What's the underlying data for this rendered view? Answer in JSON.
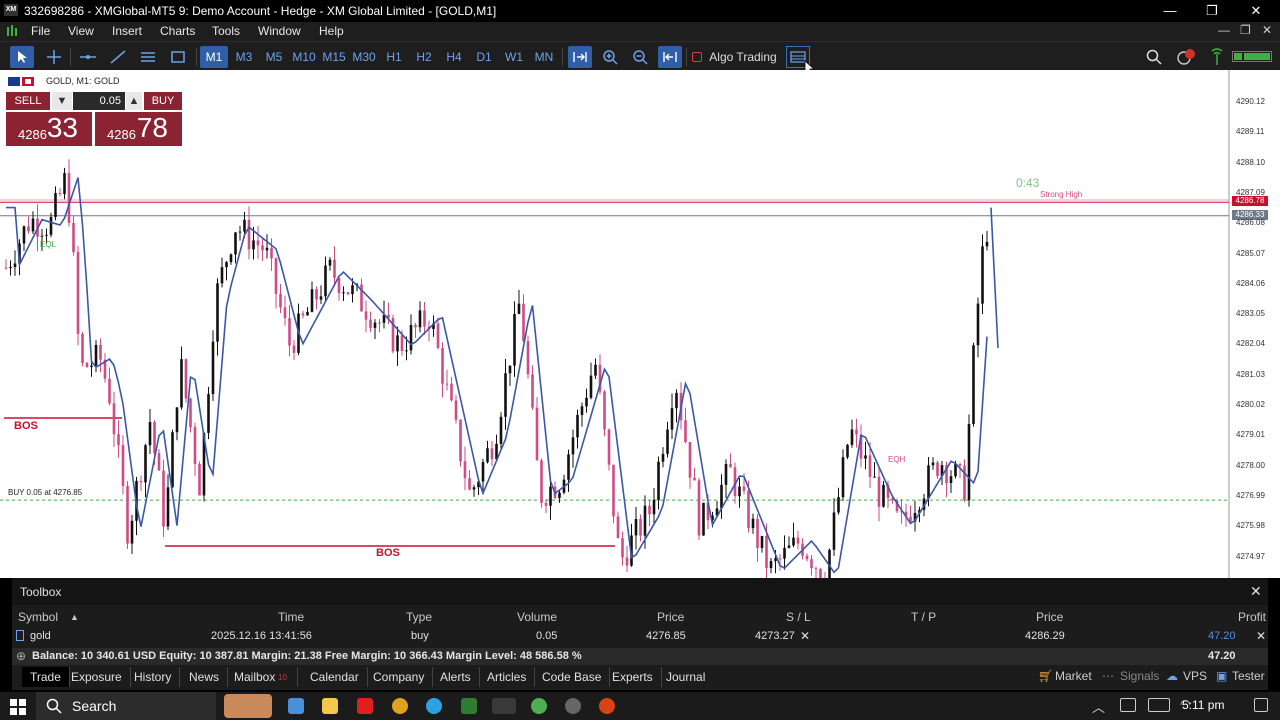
{
  "window": {
    "title": "332698286 - XMGlobal-MT5 9: Demo Account - Hedge - XM Global Limited - [GOLD,M1]",
    "logo_text": "XM",
    "min": "—",
    "restore": "❐",
    "close": "✕"
  },
  "menu": [
    "File",
    "View",
    "Insert",
    "Charts",
    "Tools",
    "Window",
    "Help"
  ],
  "toolbar": {
    "timeframes": [
      "M1",
      "M3",
      "M5",
      "M10",
      "M15",
      "M30",
      "H1",
      "H2",
      "H4",
      "D1",
      "W1",
      "MN"
    ],
    "active_timeframe": "M1",
    "algo_trading": "Algo Trading"
  },
  "chart": {
    "symbol_label": "GOLD, M1:  GOLD",
    "one_click": {
      "sell": "SELL",
      "buy": "BUY",
      "volume": "0.05",
      "sell_small": "4286",
      "sell_big": "33",
      "buy_small": "4286",
      "buy_big": "78"
    },
    "price_labels": [
      "4290.12",
      "4289.11",
      "4288.10",
      "4287.09",
      "4286.08",
      "4285.07",
      "4284.06",
      "4283.05",
      "4282.04",
      "4281.03",
      "4280.02",
      "4279.01",
      "4278.00",
      "4276.99",
      "4275.98",
      "4274.97"
    ],
    "ask_tag": "4286.78",
    "bid_tag": "4286.33",
    "annotations": {
      "timer": "0:43",
      "strong_high": "Strong High",
      "eql": "EQL",
      "eqh": "EQH",
      "bos": "BOS",
      "buy_line": "BUY 0.05 at 4276.85"
    },
    "colors": {
      "bull": "#111111",
      "bear": "#d14b86",
      "ma": "#3a57a8",
      "ask": "#c8102e",
      "buy_line": "#3cb043"
    }
  },
  "toolbox": {
    "title": "Toolbox",
    "columns": [
      "Symbol",
      "Time",
      "Type",
      "Volume",
      "Price",
      "S / L",
      "T / P",
      "Price",
      "Profit"
    ],
    "position": {
      "symbol": "gold",
      "time": "2025.12.16 13:41:56",
      "type": "buy",
      "volume": "0.05",
      "price": "4276.85",
      "sl": "4273.27",
      "tp": "",
      "current": "4286.29",
      "profit": "47.20"
    },
    "balance_line": "Balance: 10 340.61 USD  Equity: 10 387.81  Margin: 21.38  Free Margin: 10 366.43  Margin Level: 48 586.58 %",
    "total_profit": "47.20",
    "tabs": [
      "Trade",
      "Exposure",
      "History",
      "News",
      "Mailbox",
      "Calendar",
      "Company",
      "Alerts",
      "Articles",
      "Code Base",
      "Experts",
      "Journal"
    ],
    "mailbox_badge": "10",
    "active_tab": "Trade",
    "right": {
      "market": "Market",
      "signals": "Signals",
      "vps": "VPS",
      "tester": "Tester"
    }
  },
  "taskbar": {
    "search": "Search",
    "time": "5:11 pm"
  }
}
